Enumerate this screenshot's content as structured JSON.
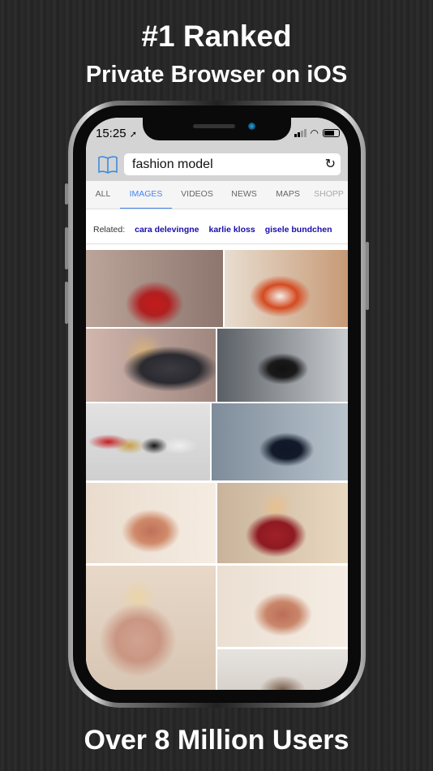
{
  "headline": {
    "top": "#1 Ranked",
    "subtitle": "Private Browser on iOS",
    "bottom": "Over 8 Million Users"
  },
  "status_bar": {
    "time": "15:25",
    "location_icon": "location-arrow-icon"
  },
  "address_bar": {
    "value": "fashion model",
    "bookmarks_icon": "book-icon",
    "reload_icon": "reload-icon"
  },
  "tabs": [
    {
      "label": "ALL",
      "active": false
    },
    {
      "label": "IMAGES",
      "active": true
    },
    {
      "label": "VIDEOS",
      "active": false
    },
    {
      "label": "NEWS",
      "active": false
    },
    {
      "label": "MAPS",
      "active": false
    },
    {
      "label": "SHOPP",
      "active": false
    }
  ],
  "related": {
    "label": "Related:",
    "links": [
      "cara delevingne",
      "karlie kloss",
      "gisele bundchen"
    ]
  },
  "colors": {
    "accent": "#4285f4",
    "link": "#1a0dab",
    "bookmark_icon": "#3b8ce0"
  }
}
